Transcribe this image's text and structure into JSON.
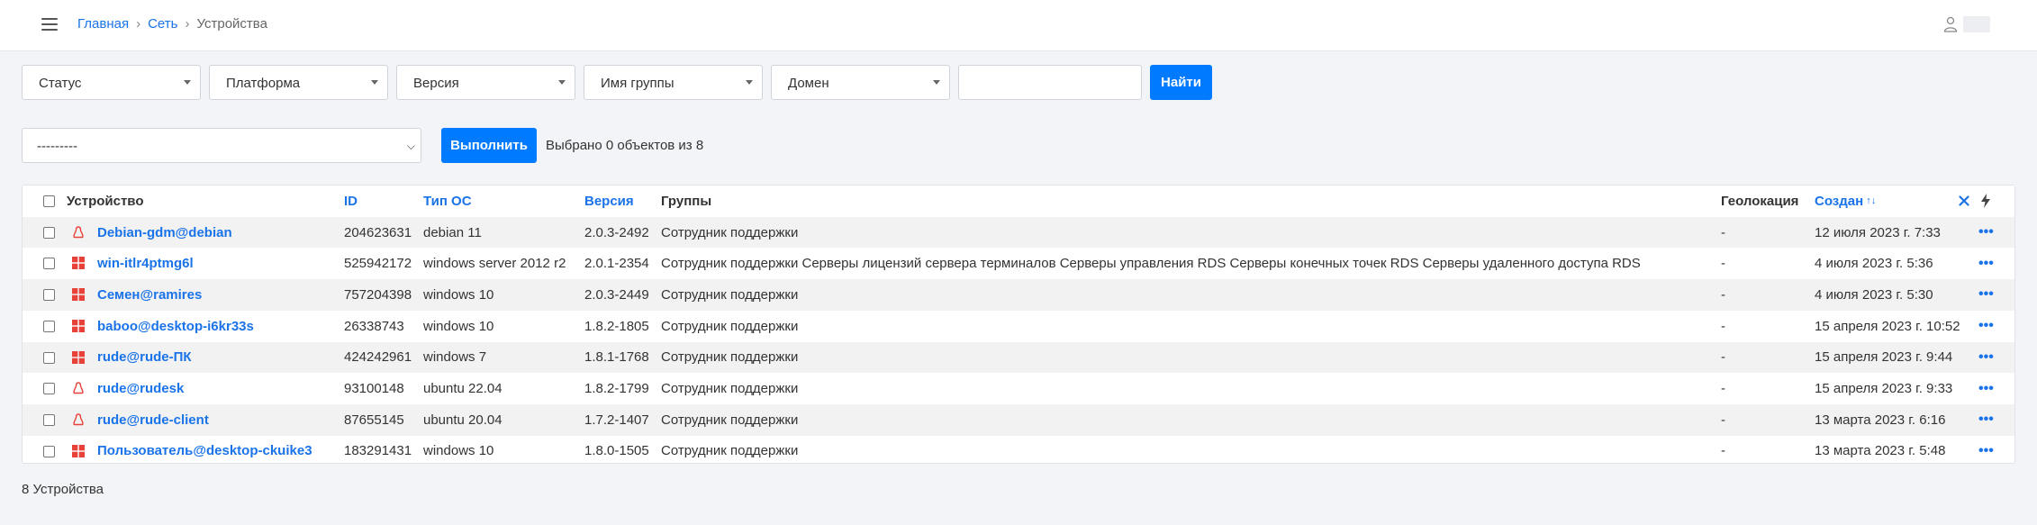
{
  "breadcrumb": {
    "home": "Главная",
    "network": "Сеть",
    "current": "Устройства"
  },
  "filters": {
    "status": "Статус",
    "platform": "Платформа",
    "version": "Версия",
    "group": "Имя группы",
    "domain": "Домен",
    "search_value": "",
    "find_button": "Найти"
  },
  "actions": {
    "select_value": "---------",
    "run_button": "Выполнить",
    "selected_text": "Выбрано 0 объектов из 8"
  },
  "table": {
    "headers": {
      "device": "Устройство",
      "id": "ID",
      "os_type": "Тип ОС",
      "version": "Версия",
      "groups": "Группы",
      "geo": "Геолокация",
      "created": "Создан"
    },
    "rows": [
      {
        "os": "linux",
        "device": "Debian-gdm@debian",
        "id": "204623631",
        "os_type": "debian 11",
        "version": "2.0.3-2492",
        "groups": "Сотрудник поддержки",
        "geo": "-",
        "created": "12 июля 2023 г. 7:33"
      },
      {
        "os": "windows",
        "device": "win-itlr4ptmg6l",
        "id": "525942172",
        "os_type": "windows server 2012 r2",
        "version": "2.0.1-2354",
        "groups": "Сотрудник поддержки Серверы лицензий сервера терминалов Серверы управления RDS Серверы конечных точек RDS Серверы удаленного доступа RDS",
        "geo": "-",
        "created": "4 июля 2023 г. 5:36"
      },
      {
        "os": "windows",
        "device": "Семен@ramires",
        "id": "757204398",
        "os_type": "windows 10",
        "version": "2.0.3-2449",
        "groups": "Сотрудник поддержки",
        "geo": "-",
        "created": "4 июля 2023 г. 5:30"
      },
      {
        "os": "windows",
        "device": "baboo@desktop-i6kr33s",
        "id": "26338743",
        "os_type": "windows 10",
        "version": "1.8.2-1805",
        "groups": "Сотрудник поддержки",
        "geo": "-",
        "created": "15 апреля 2023 г. 10:52"
      },
      {
        "os": "windows",
        "device": "rude@rude-ПК",
        "id": "424242961",
        "os_type": "windows 7",
        "version": "1.8.1-1768",
        "groups": "Сотрудник поддержки",
        "geo": "-",
        "created": "15 апреля 2023 г. 9:44"
      },
      {
        "os": "linux",
        "device": "rude@rudesk",
        "id": "93100148",
        "os_type": "ubuntu 22.04",
        "version": "1.8.2-1799",
        "groups": "Сотрудник поддержки",
        "geo": "-",
        "created": "15 апреля 2023 г. 9:33"
      },
      {
        "os": "linux",
        "device": "rude@rude-client",
        "id": "87655145",
        "os_type": "ubuntu 20.04",
        "version": "1.7.2-1407",
        "groups": "Сотрудник поддержки",
        "geo": "-",
        "created": "13 марта 2023 г. 6:16"
      },
      {
        "os": "windows",
        "device": "Пользователь@desktop-ckuike3",
        "id": "183291431",
        "os_type": "windows 10",
        "version": "1.8.0-1505",
        "groups": "Сотрудник поддержки",
        "geo": "-",
        "created": "13 марта 2023 г. 5:48"
      }
    ]
  },
  "footer": {
    "count_text": "8 Устройства"
  },
  "colors": {
    "accent": "#007bff",
    "link": "#1a73e8",
    "windows_icon": "#e8413a",
    "linux_icon": "#e8413a"
  },
  "icons": {
    "menu": "hamburger-icon",
    "user": "user-icon",
    "clear": "close-icon",
    "bolt": "lightning-icon",
    "more": "more-dots-icon",
    "sort": "sort-asc-icon"
  }
}
